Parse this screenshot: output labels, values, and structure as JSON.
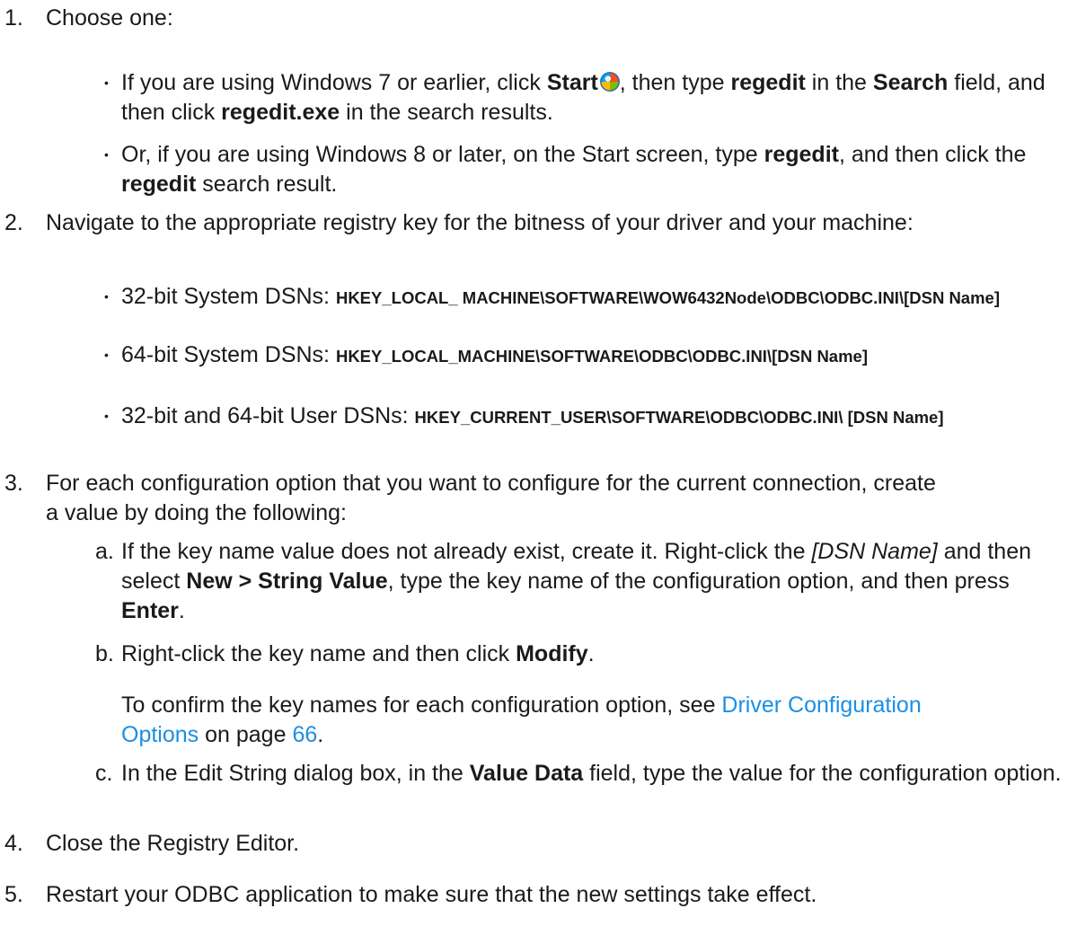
{
  "steps": [
    {
      "num": "1.",
      "text": "Choose one:"
    },
    {
      "num": "2.",
      "text": "Navigate to the appropriate registry key for the bitness of your driver and your machine:"
    },
    {
      "num": "3.",
      "text": "For each configuration option that you want to configure for the current connection, create a value by doing the following:"
    },
    {
      "num": "4.",
      "text": "Close the Registry Editor."
    },
    {
      "num": "5.",
      "text": "Restart your ODBC application to make sure that the new settings take effect."
    }
  ],
  "step1_bullets": [
    {
      "p1": "If you are using Windows 7 or earlier, click ",
      "b1": "Start",
      "p2": ", then type ",
      "b2": "regedit",
      "p3": " in the ",
      "b3": "Search",
      "p4": " field, and then click ",
      "b4": "regedit.exe",
      "p5": " in the search results."
    },
    {
      "p1": "Or, if you are using Windows 8 or later, on the Start screen, type ",
      "b1": "regedit",
      "p2": ", and then click the ",
      "b2": "regedit",
      "p3": " search result."
    }
  ],
  "step2_bullets": [
    {
      "label": "32-bit System DSNs: ",
      "path": "HKEY_LOCAL_ MACHINE\\SOFTWARE\\WOW6432Node\\ODBC\\ODBC.INI\\[DSN Name]"
    },
    {
      "label": "64-bit System DSNs: ",
      "path": "HKEY_LOCAL_MACHINE\\SOFTWARE\\ODBC\\ODBC.INI\\[DSN Name]"
    },
    {
      "label": "32-bit and 64-bit User DSNs: ",
      "path": "HKEY_CURRENT_USER\\SOFTWARE\\ODBC\\ODBC.INI\\ [DSN Name]"
    }
  ],
  "step3_sub": [
    {
      "letter": "a.",
      "p1": "If the key name value does not already exist, create it. Right-click the ",
      "i1": "[DSN Name]",
      "p2": " and then select ",
      "b1": "New > String Value",
      "p3": ", type the key name of the configuration option, and then press ",
      "b2": "Enter",
      "p4": "."
    },
    {
      "letter": "b.",
      "p1": "Right-click the key name and then click ",
      "b1": "Modify",
      "p2": "."
    },
    {
      "letter": "c.",
      "p1": "In the Edit String dialog box, in the ",
      "b1": "Value Data",
      "p2": " field, type the value for the configuration option."
    }
  ],
  "step3b_note": {
    "p1": "To confirm the key names for each configuration option, see ",
    "link": "Driver Configuration Options",
    "p2": " on page ",
    "page": "66",
    "p3": "."
  },
  "bullet_glyph": "•",
  "colors": {
    "text": "#1a1a1a",
    "link": "#1a8fe6"
  },
  "icons": {
    "start": "windows-start-orb-icon"
  }
}
